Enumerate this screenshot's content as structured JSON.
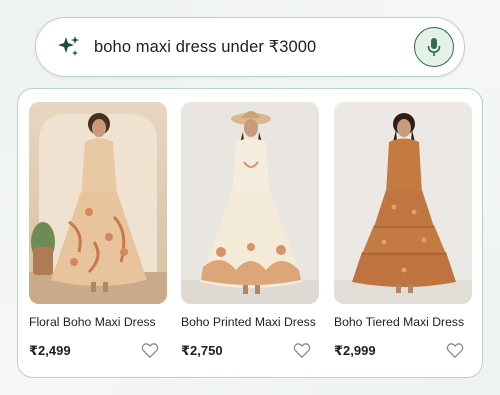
{
  "search": {
    "query": "boho maxi dress under ₹3000",
    "icon": "sparkle-icon",
    "mic_icon": "microphone-icon",
    "accent": "#2f6a4a"
  },
  "products": [
    {
      "name": "Floral Boho Maxi Dress",
      "price": "₹2,499",
      "image": "floral-boho-dress-photo",
      "favorite_icon": "heart-outline-icon"
    },
    {
      "name": "Boho Printed Maxi Dress",
      "price": "₹2,750",
      "image": "printed-boho-dress-photo",
      "favorite_icon": "heart-outline-icon"
    },
    {
      "name": "Boho Tiered Maxi Dress",
      "price": "₹2,999",
      "image": "tiered-boho-dress-photo",
      "favorite_icon": "heart-outline-icon"
    }
  ]
}
